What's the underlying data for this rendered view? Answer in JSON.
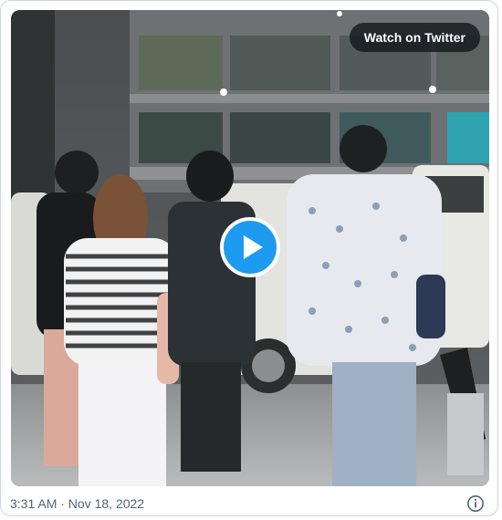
{
  "embed": {
    "watch_label": "Watch on Twitter",
    "timestamp": "3:31 AM · Nov 18, 2022",
    "play_icon": "play-icon",
    "info_icon": "info-icon",
    "accent_color": "#1d9bf0"
  }
}
